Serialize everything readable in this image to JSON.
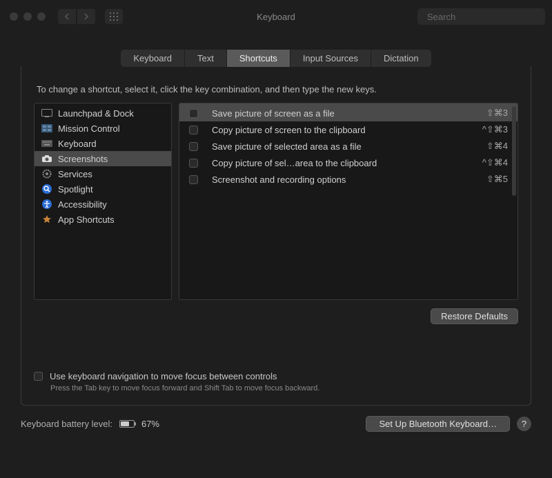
{
  "window": {
    "title": "Keyboard"
  },
  "search": {
    "placeholder": "Search"
  },
  "tabs": [
    {
      "label": "Keyboard",
      "active": false
    },
    {
      "label": "Text",
      "active": false
    },
    {
      "label": "Shortcuts",
      "active": true
    },
    {
      "label": "Input Sources",
      "active": false
    },
    {
      "label": "Dictation",
      "active": false
    }
  ],
  "instruction": "To change a shortcut, select it, click the key combination, and then type the new keys.",
  "categories": [
    {
      "icon": "launchpad",
      "label": "Launchpad & Dock",
      "selected": false
    },
    {
      "icon": "mission",
      "label": "Mission Control",
      "selected": false
    },
    {
      "icon": "keyboard",
      "label": "Keyboard",
      "selected": false
    },
    {
      "icon": "camera",
      "label": "Screenshots",
      "selected": true
    },
    {
      "icon": "gear",
      "label": "Services",
      "selected": false
    },
    {
      "icon": "spotlight",
      "label": "Spotlight",
      "selected": false
    },
    {
      "icon": "access",
      "label": "Accessibility",
      "selected": false
    },
    {
      "icon": "appshort",
      "label": "App Shortcuts",
      "selected": false
    }
  ],
  "shortcuts": [
    {
      "checked": false,
      "label": "Save picture of screen as a file",
      "keys": "⇧⌘3",
      "selected": true
    },
    {
      "checked": false,
      "label": "Copy picture of screen to the clipboard",
      "keys": "^⇧⌘3",
      "selected": false
    },
    {
      "checked": false,
      "label": "Save picture of selected area as a file",
      "keys": "⇧⌘4",
      "selected": false
    },
    {
      "checked": false,
      "label": "Copy picture of sel…area to the clipboard",
      "keys": "^⇧⌘4",
      "selected": false
    },
    {
      "checked": false,
      "label": "Screenshot and recording options",
      "keys": "⇧⌘5",
      "selected": false
    }
  ],
  "buttons": {
    "restore": "Restore Defaults",
    "bluetooth": "Set Up Bluetooth Keyboard…"
  },
  "kbnav": {
    "label": "Use keyboard navigation to move focus between controls",
    "hint": "Press the Tab key to move focus forward and Shift Tab to move focus backward."
  },
  "battery": {
    "label": "Keyboard battery level:",
    "percent_text": "67%",
    "percent": 67
  },
  "help": "?"
}
